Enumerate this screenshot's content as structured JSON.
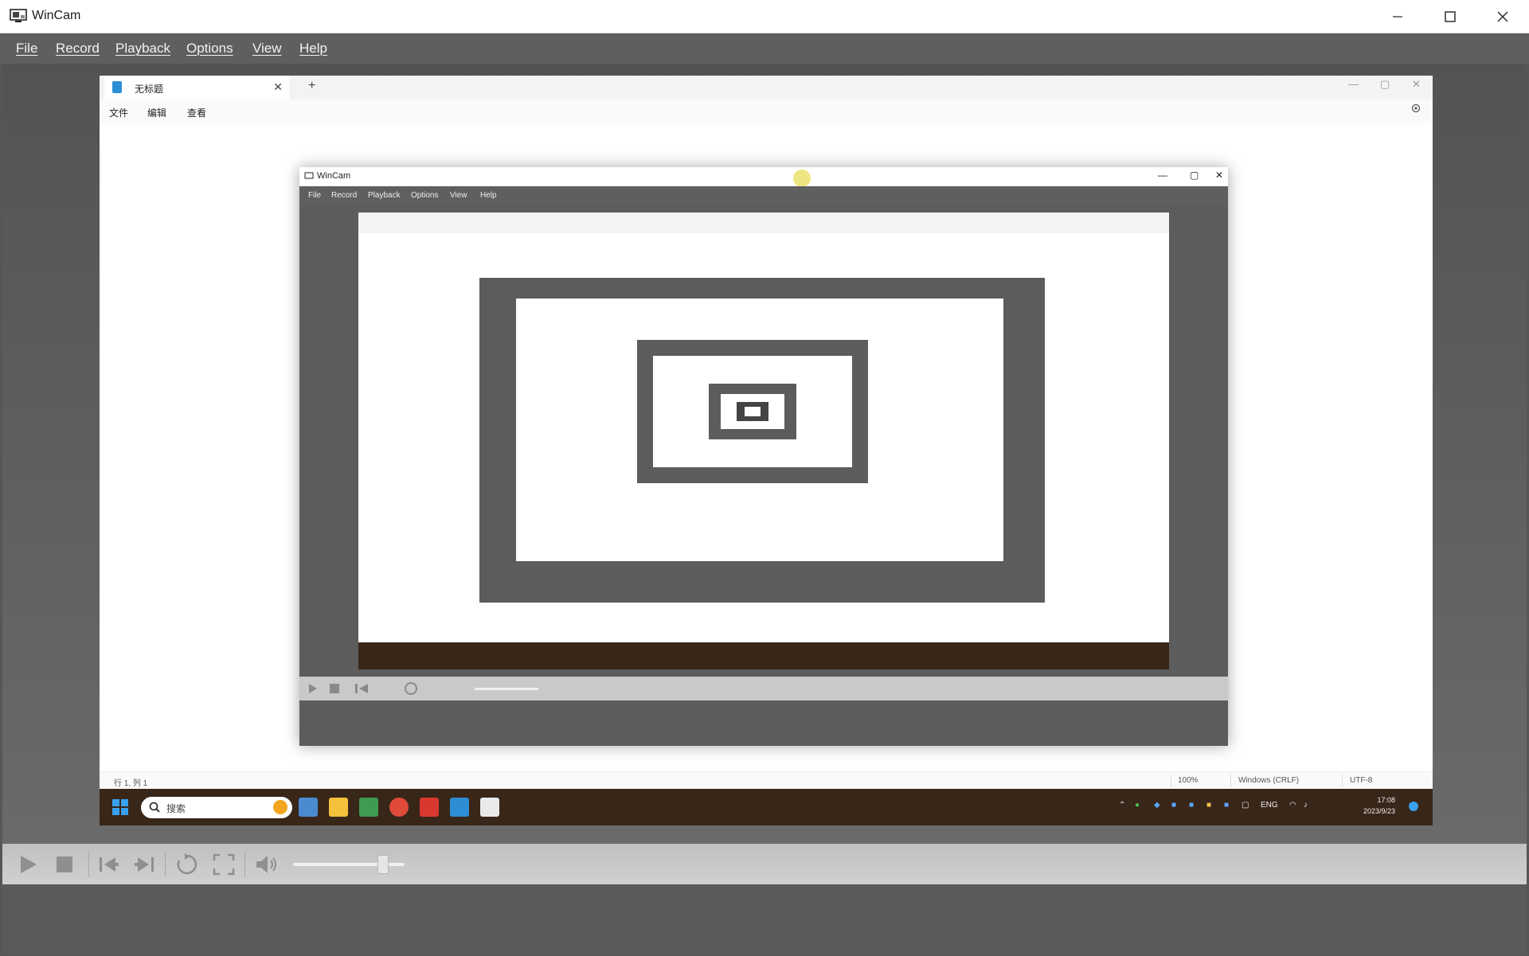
{
  "window": {
    "title": "WinCam"
  },
  "menu": [
    "File",
    "Record",
    "Playback",
    "Options",
    "View",
    "Help"
  ],
  "capture": {
    "notepad": {
      "tab_title": "无标题",
      "menu": [
        "文件",
        "编辑",
        "查看"
      ],
      "status": {
        "position": "行 1, 列 1",
        "zoom": "100%",
        "line_ending": "Windows (CRLF)",
        "encoding": "UTF-8"
      }
    },
    "taskbar": {
      "search_placeholder": "搜索",
      "tray_lang": "ENG",
      "time": "17:08",
      "date": "2023/9/23"
    },
    "nested_wincam": {
      "title": "WinCam",
      "menu": [
        "File",
        "Record",
        "Playback",
        "Options",
        "View",
        "Help"
      ]
    }
  },
  "controls": {
    "buttons": [
      "play-icon",
      "stop-icon",
      "skip-back-icon",
      "skip-forward-icon",
      "loop-icon",
      "fullscreen-icon",
      "volume-icon"
    ],
    "volume_level": 0.8
  },
  "colors": {
    "menubar": "#5f5f5f",
    "taskbar": "#382619",
    "controlbar": "#c8c8c8"
  }
}
